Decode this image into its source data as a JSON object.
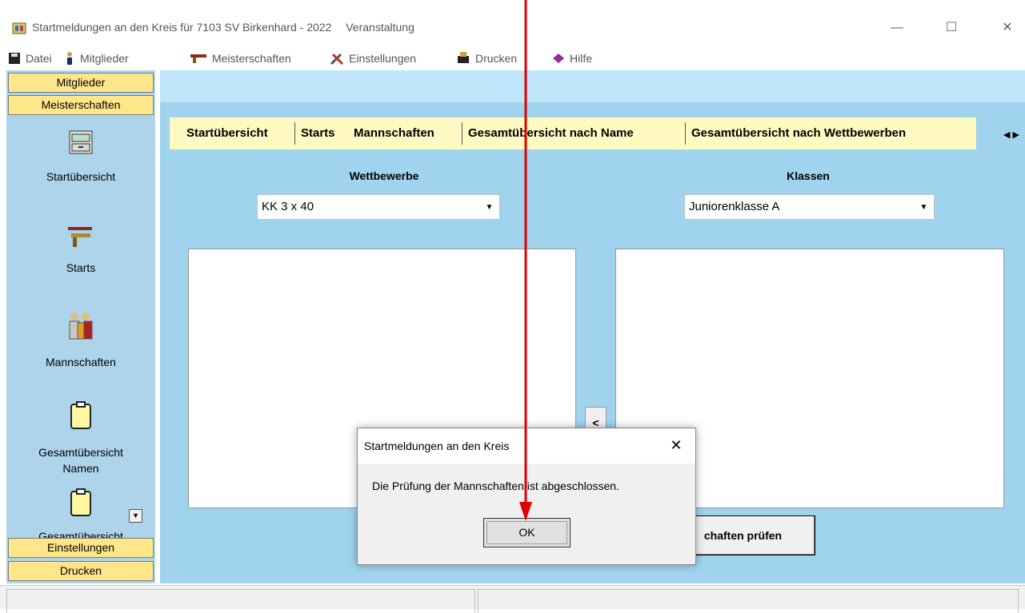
{
  "window": {
    "title": "Startmeldungen an den Kreis für 7103 SV Birkenhard - 2022",
    "title_suffix": "Veranstaltung",
    "controls": {
      "minimize": "—",
      "maximize": "☐",
      "close": "✕"
    }
  },
  "menu": [
    {
      "key": "datei",
      "label": "Datei",
      "icon": "save-icon"
    },
    {
      "key": "mitglieder",
      "label": "Mitglieder",
      "icon": "person-icon"
    },
    {
      "key": "meisterschaften",
      "label": "Meisterschaften",
      "icon": "gun-icon"
    },
    {
      "key": "einstellungen",
      "label": "Einstellungen",
      "icon": "tools-icon"
    },
    {
      "key": "drucken",
      "label": "Drucken",
      "icon": "printer-icon"
    },
    {
      "key": "hilfe",
      "label": "Hilfe",
      "icon": "help-book-icon"
    }
  ],
  "sidebar": {
    "headers_top": [
      "Mitglieder",
      "Meisterschaften"
    ],
    "headers_bottom": [
      "Einstellungen",
      "Drucken"
    ],
    "items": [
      {
        "label": "Startübersicht",
        "icon": "cabinet-icon"
      },
      {
        "label": "Starts",
        "icon": "guns-icon"
      },
      {
        "label": "Mannschaften",
        "icon": "team-icon"
      },
      {
        "label": "Gesamtübersicht",
        "label2": "Namen",
        "icon": "clipboard-icon"
      },
      {
        "label": "Gesamtübersicht",
        "icon": "clipboard-icon"
      }
    ],
    "scroll_down": "▼"
  },
  "tabs": [
    "Startübersicht",
    "Starts",
    "Mannschaften",
    "Gesamtübersicht nach Name",
    "Gesamtübersicht nach Wettbewerben"
  ],
  "tab_arrows": "◀ ▶",
  "wettbewerbe": {
    "label": "Wettbewerbe",
    "selected": "KK 3 x 40"
  },
  "klassen": {
    "label": "Klassen",
    "selected": "Juniorenklasse A"
  },
  "move_left_label": "<",
  "check_button_label": "chaften prüfen",
  "dialog": {
    "title": "Startmeldungen an den Kreis",
    "message": "Die Prüfung der Mannschaften ist abgeschlossen.",
    "ok_label": "OK",
    "close": "✕"
  },
  "colors": {
    "sidebar_header": "#ffe68a",
    "main_bg": "#9fd3ee",
    "tabs_bg": "#fff9c2",
    "annotation": "#e00000"
  }
}
